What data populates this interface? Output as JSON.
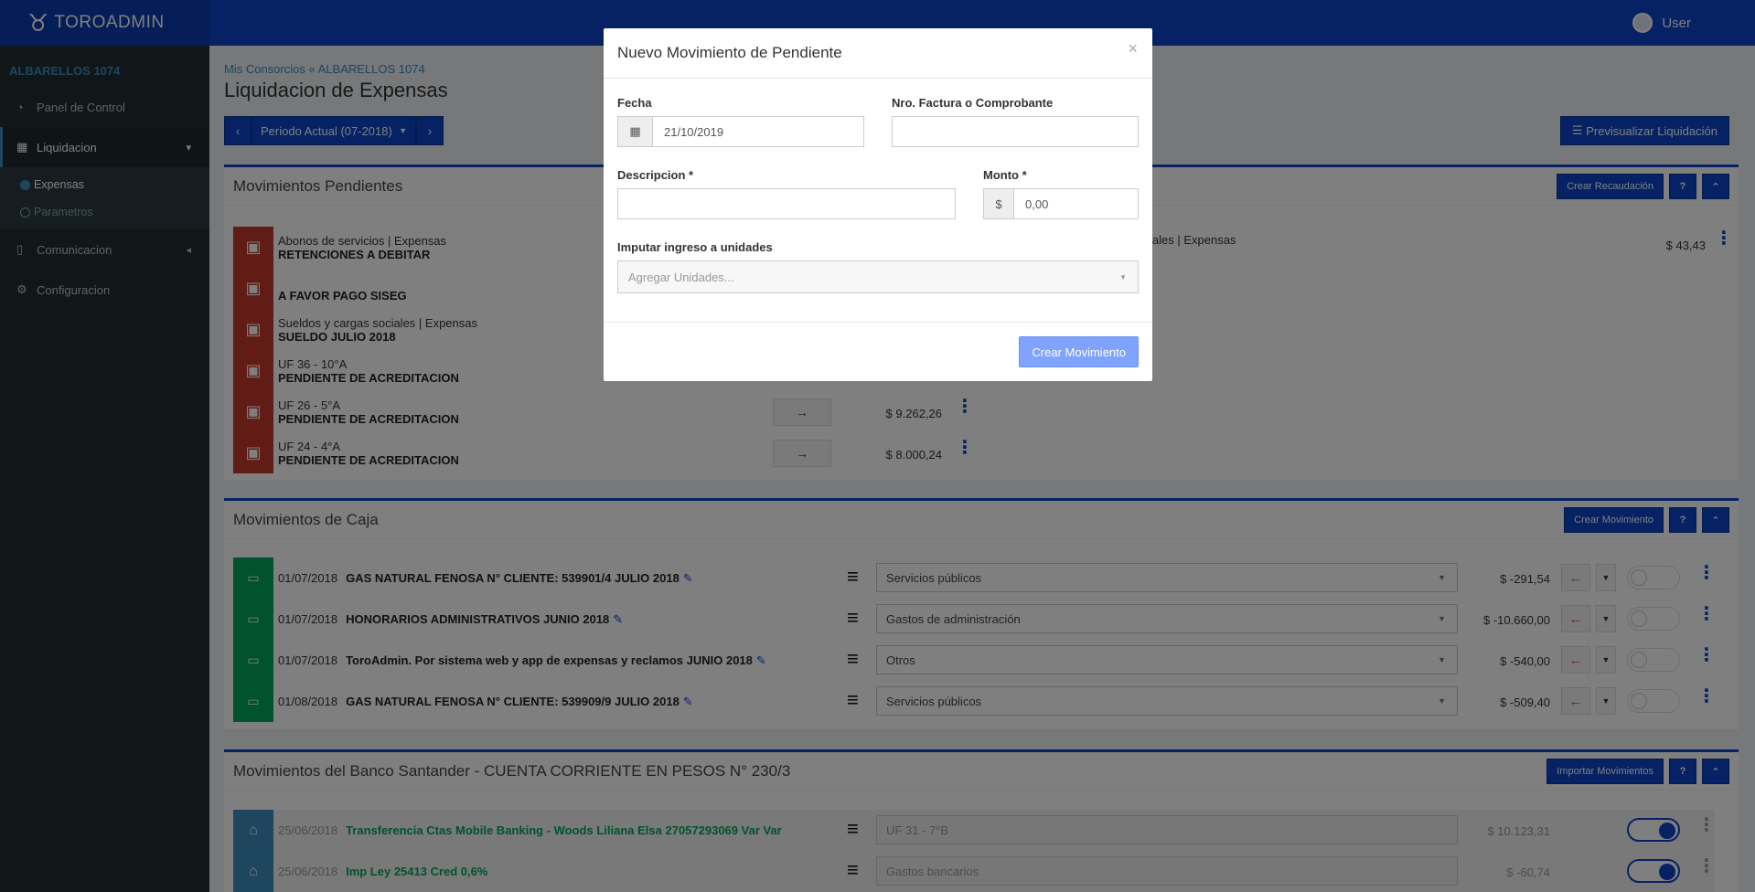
{
  "app": {
    "brand": "TOROADMIN",
    "user": "User"
  },
  "sidebar": {
    "title": "ALBARELLOS 1074",
    "items": [
      {
        "label": "Panel de Control"
      },
      {
        "label": "Liquidacion"
      },
      {
        "label": "Comunicacion"
      },
      {
        "label": "Configuracion"
      }
    ],
    "sub": [
      {
        "label": "Expensas"
      },
      {
        "label": "Parametros"
      }
    ]
  },
  "breadcrumb": {
    "parent": "Mis Consorcios",
    "current": "ALBARELLOS 1074"
  },
  "page_title": "Liquidacion de Expensas",
  "period": "Periodo Actual (07-2018)",
  "preview_button": "Previsualizar Liquidación",
  "pendientes": {
    "title": "Movimientos Pendientes",
    "create": "Crear Recaudación",
    "help": "?",
    "rows": [
      {
        "sub": "Abonos de servicios | Expensas",
        "main": "RETENCIONES A DEBITAR"
      },
      {
        "sub": "",
        "main": "A FAVOR PAGO SISEG"
      },
      {
        "sub": "Sueldos y cargas sociales | Expensas",
        "main": "SUELDO JULIO 2018"
      },
      {
        "sub": "UF 36 - 10°A",
        "main": "PENDIENTE DE ACREDITACION"
      },
      {
        "sub": "UF 26 - 5°A",
        "main": "PENDIENTE DE ACREDITACION",
        "amount": "$ 9.262,26"
      },
      {
        "sub": "UF 24 - 4°A",
        "main": "PENDIENTE DE ACREDITACION",
        "amount": "$ 8.000,24"
      }
    ],
    "right_row": {
      "text": "iales | Expensas",
      "amount": "$ 43,43"
    }
  },
  "caja": {
    "title": "Movimientos de Caja",
    "create": "Crear Movimiento",
    "help": "?",
    "rows": [
      {
        "date": "01/07/2018",
        "desc": "GAS NATURAL FENOSA N° CLIENTE: 539901/4 JULIO 2018",
        "cat": "Servicios públicos",
        "amount": "$ -291,54"
      },
      {
        "date": "01/07/2018",
        "desc": "HONORARIOS ADMINISTRATIVOS JUNIO 2018",
        "cat": "Gastos de administración",
        "amount": "$ -10.660,00"
      },
      {
        "date": "01/07/2018",
        "desc": "ToroAdmin. Por sistema web y app de expensas y reclamos JUNIO 2018",
        "cat": "Otros",
        "amount": "$ -540,00"
      },
      {
        "date": "01/08/2018",
        "desc": "GAS NATURAL FENOSA N° CLIENTE: 539909/9 JULIO 2018",
        "cat": "Servicios públicos",
        "amount": "$ -509,40"
      }
    ]
  },
  "banco": {
    "title": "Movimientos del Banco Santander - CUENTA CORRIENTE EN PESOS N° 230/3",
    "import": "Importar Movimientos",
    "help": "?",
    "rows": [
      {
        "date": "25/06/2018",
        "desc": "Transferencia Ctas Mobile Banking - Woods Liliana Elsa 27057293069 Var Var",
        "cat": "UF 31 - 7°B",
        "amount": "$ 10.123,31"
      },
      {
        "date": "25/06/2018",
        "desc": "Imp Ley 25413 Cred 0,6%",
        "cat": "Gastos bancarios",
        "amount": "$ -60,74"
      }
    ]
  },
  "modal": {
    "title": "Nuevo Movimiento de Pendiente",
    "close": "×",
    "fecha_label": "Fecha",
    "fecha_value": "21/10/2019",
    "factura_label": "Nro. Factura o Comprobante",
    "desc_label": "Descripcion *",
    "monto_label": "Monto *",
    "monto_prefix": "$",
    "monto_value": "0,00",
    "unidades_label": "Imputar ingreso a unidades",
    "unidades_placeholder": "Agregar Unidades...",
    "submit": "Crear Movimiento"
  }
}
